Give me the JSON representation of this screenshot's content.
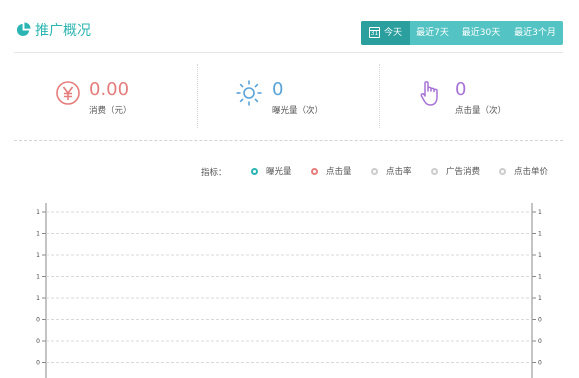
{
  "header": {
    "title": "推广概况",
    "title_icon": "pie-chart-icon",
    "range_buttons": [
      {
        "label": "今天",
        "icon": "calendar-icon",
        "icon_text": "31",
        "active": true
      },
      {
        "label": "最近7天",
        "active": false
      },
      {
        "label": "最近30天",
        "active": false
      },
      {
        "label": "最近3个月",
        "active": false
      }
    ]
  },
  "stats": [
    {
      "icon": "yen-circle-icon",
      "value": "0.00",
      "label": "消费（元）",
      "color": "#e57d7d"
    },
    {
      "icon": "sun-icon",
      "value": "0",
      "label": "曝光量（次）",
      "color": "#5aa3d8"
    },
    {
      "icon": "hand-pointer-icon",
      "value": "0",
      "label": "点击量（次）",
      "color": "#a873d6"
    }
  ],
  "metrics": {
    "label": "指标：",
    "items": [
      {
        "label": "曝光量",
        "color": "#2bb5b2",
        "selected": true
      },
      {
        "label": "点击量",
        "color": "#e57d7d",
        "selected": true
      },
      {
        "label": "点击率",
        "color": "#cccccc",
        "selected": false
      },
      {
        "label": "广告消费",
        "color": "#cccccc",
        "selected": false
      },
      {
        "label": "点击单价",
        "color": "#cccccc",
        "selected": false
      }
    ]
  },
  "chart_data": {
    "type": "line",
    "title": "",
    "xlabel": "",
    "ylabel": "",
    "grid": true,
    "y_ticks_left": [
      "1",
      "1",
      "1",
      "1",
      "1",
      "0",
      "0",
      "0"
    ],
    "y_ticks_right": [
      "1",
      "1",
      "1",
      "1",
      "1",
      "0",
      "0",
      "0"
    ],
    "series": []
  },
  "colors": {
    "accent": "#2bb5b2",
    "range_bg": "#53c4c3",
    "range_active": "#2a9f9e"
  }
}
